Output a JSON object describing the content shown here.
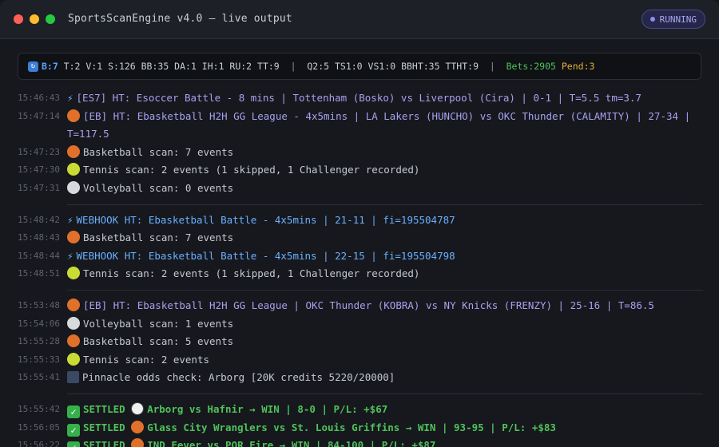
{
  "window": {
    "title": "SportsScanEngine v4.0 — live output",
    "status": "RUNNING"
  },
  "statusbar": {
    "icon": "refresh-icon",
    "b7": "B:7",
    "counts": " T:2 V:1 S:126 BB:35 DA:1 IH:1 RU:2 TT:9  ",
    "sep1": "|",
    "counts2": "  Q2:5 TS1:0 VS1:0 BBHT:35 TTHT:9  ",
    "sep2": "|",
    "bets": "  Bets:2905 ",
    "pend": "Pend:3"
  },
  "log": [
    {
      "ts": "15:46:43",
      "icon": "bolt",
      "style": "purple",
      "text": "[ES7] HT: Esoccer Battle - 8 mins | Tottenham (Bosko) vs Liverpool (Cira) | 0-1 | T=5.5 tm=3.7"
    },
    {
      "ts": "15:47:14",
      "icon": "basketball",
      "style": "purple",
      "text": "[EB] HT: Ebasketball H2H GG League - 4x5mins | LA Lakers (HUNCHO) vs OKC Thunder (CALAMITY) | 27-34 | T=117.5"
    },
    {
      "ts": "15:47:23",
      "icon": "basketball",
      "style": "gray",
      "text": "Basketball scan: 7 events"
    },
    {
      "ts": "15:47:30",
      "icon": "tennis",
      "style": "gray",
      "text": "Tennis scan: 2 events (1 skipped, 1 Challenger recorded)"
    },
    {
      "ts": "15:47:31",
      "icon": "volleyball",
      "style": "gray",
      "text": "Volleyball scan: 0 events"
    },
    {
      "sep": true
    },
    {
      "ts": "15:48:42",
      "icon": "bolt",
      "style": "blue",
      "text": "WEBHOOK HT: Ebasketball Battle - 4x5mins | 21-11 | fi=195504787"
    },
    {
      "ts": "15:48:43",
      "icon": "basketball",
      "style": "gray",
      "text": "Basketball scan: 7 events"
    },
    {
      "ts": "15:48:44",
      "icon": "bolt",
      "style": "blue",
      "text": "WEBHOOK HT: Ebasketball Battle - 4x5mins | 22-15 | fi=195504798"
    },
    {
      "ts": "15:48:51",
      "icon": "tennis",
      "style": "gray",
      "text": "Tennis scan: 2 events (1 skipped, 1 Challenger recorded)"
    },
    {
      "sep": true
    },
    {
      "ts": "15:53:48",
      "icon": "basketball",
      "style": "purple",
      "text": "[EB] HT: Ebasketball H2H GG League | OKC Thunder (KOBRA) vs NY Knicks (FRENZY) | 25-16 | T=86.5"
    },
    {
      "ts": "15:54:06",
      "icon": "volleyball",
      "style": "gray",
      "text": "Volleyball scan: 1 events"
    },
    {
      "ts": "15:55:28",
      "icon": "basketball",
      "style": "gray",
      "text": "Basketball scan: 5 events"
    },
    {
      "ts": "15:55:33",
      "icon": "tennis",
      "style": "gray",
      "text": "Tennis scan: 2 events"
    },
    {
      "ts": "15:55:41",
      "icon": "chart",
      "style": "gray",
      "text": "Pinnacle odds check: Arborg [20K credits 5220/20000]"
    },
    {
      "sep": true
    },
    {
      "ts": "15:55:42",
      "icon": "check",
      "icon2": "soccer",
      "style": "green",
      "label": "SETTLED",
      "text": "Arborg vs Hafnir → WIN | 8-0 | P/L: +$67"
    },
    {
      "ts": "15:56:05",
      "icon": "check",
      "icon2": "basketball",
      "style": "green",
      "label": "SETTLED",
      "text": "Glass City Wranglers vs St. Louis Griffins → WIN | 93-95 | P/L: +$83"
    },
    {
      "ts": "15:56:22",
      "icon": "check",
      "icon2": "basketball",
      "style": "green",
      "label": "SETTLED",
      "text": "IND Fever vs POR Fire → WIN | 84-100 | P/L: +$87"
    }
  ]
}
